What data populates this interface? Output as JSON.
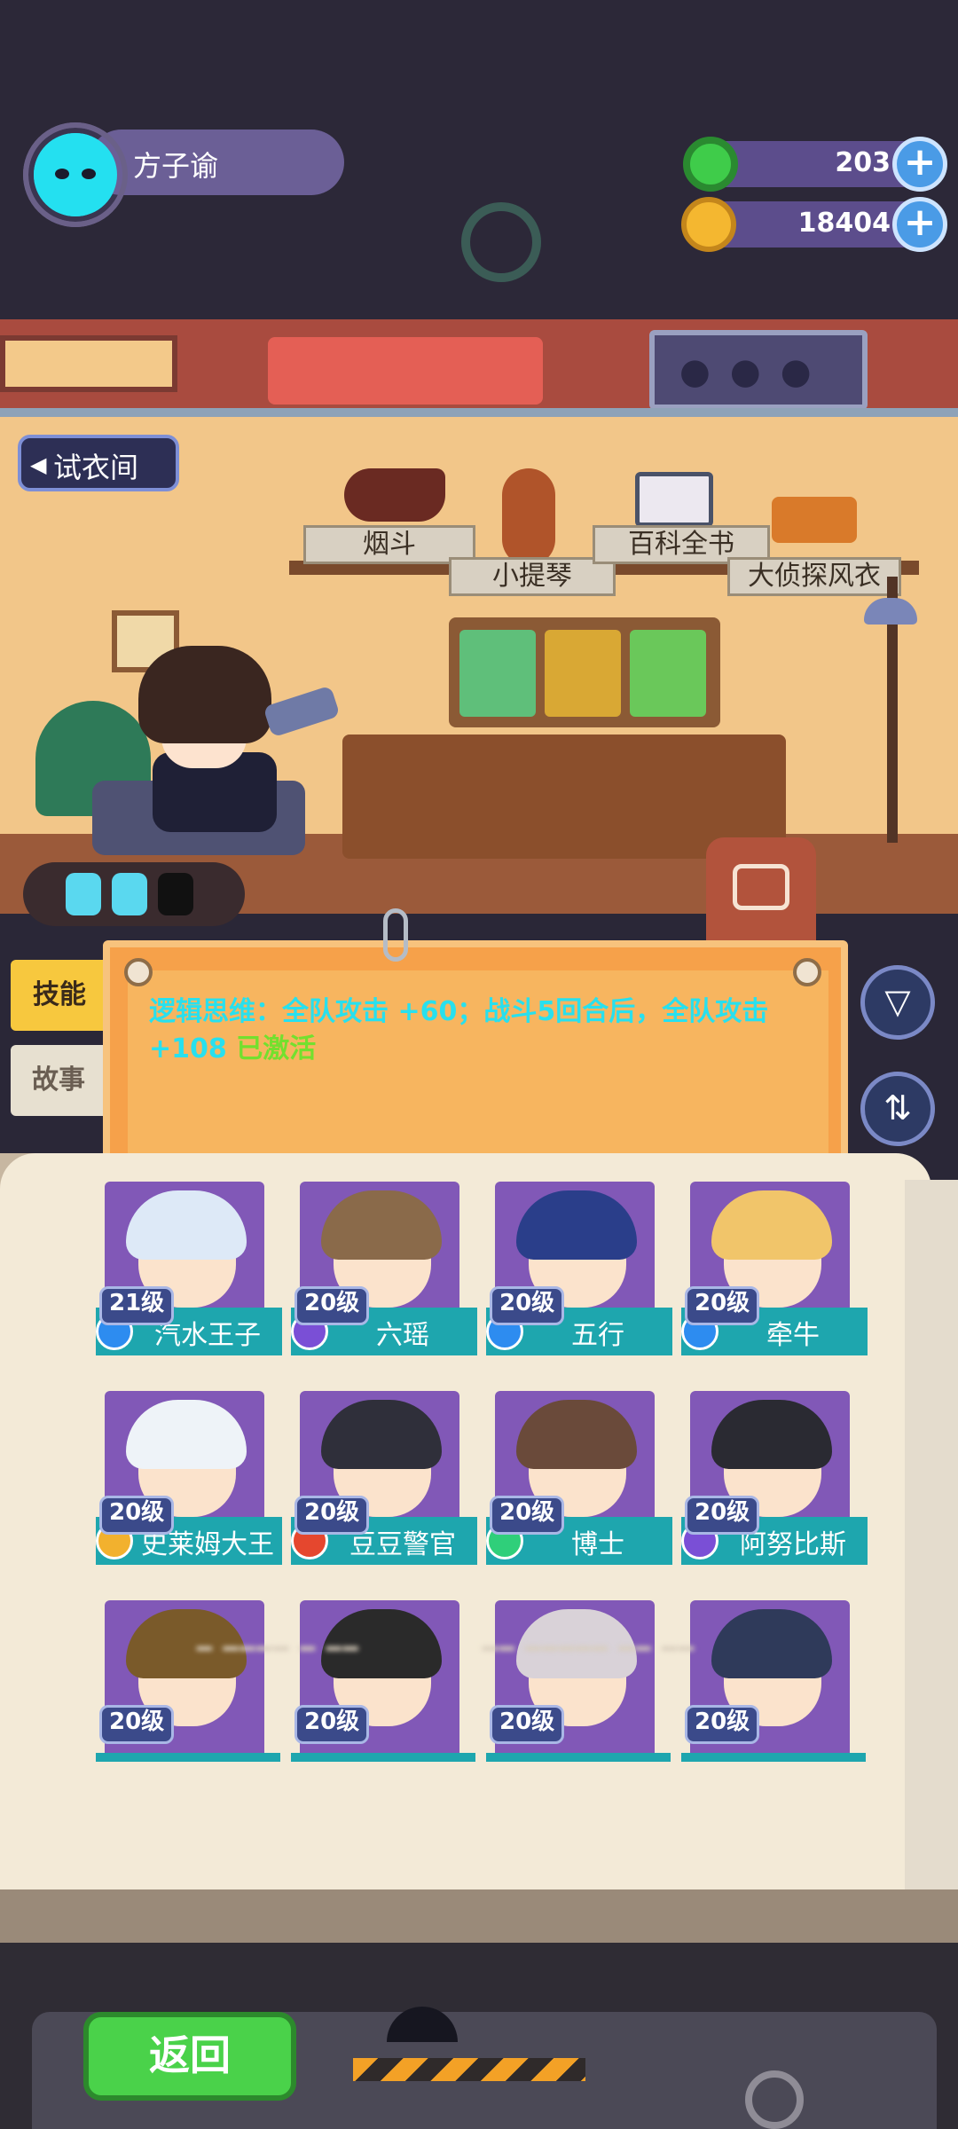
{
  "hud": {
    "player_name": "方子谕",
    "currency_green": {
      "value": "203",
      "icon": "green-donut-icon",
      "color": "#3fcc4a"
    },
    "currency_gold": {
      "value": "18404",
      "icon": "gold-planet-icon",
      "color": "#f4b730"
    },
    "add_icon": "plus-icon"
  },
  "room": {
    "dressing_room_label": "试衣间",
    "shelf_items": [
      {
        "label": "烟斗",
        "icon": "pipe-icon"
      },
      {
        "label": "小提琴",
        "icon": "violin-icon"
      },
      {
        "label": "百科全书",
        "icon": "encyclopedia-icon"
      },
      {
        "label": "大侦探风衣",
        "icon": "coat-icon"
      }
    ]
  },
  "tabs": {
    "skill": "技能",
    "story": "故事"
  },
  "skill": {
    "text": "逻辑思维：全队攻击 +60；战斗5回合后，全队攻击 +108",
    "status": "已激活"
  },
  "side_buttons": {
    "filter_icon": "filter-icon",
    "sort_icon": "sort-icon"
  },
  "characters": [
    {
      "name": "汽水王子",
      "level": "21级",
      "badge_color": "#2d8cf0",
      "hair": "#dde9f7"
    },
    {
      "name": "六瑶",
      "level": "20级",
      "badge_color": "#7a4fd6",
      "hair": "#8a6a4a"
    },
    {
      "name": "五行",
      "level": "20级",
      "badge_color": "#2d8cf0",
      "hair": "#2a3e8a"
    },
    {
      "name": "牵牛",
      "level": "20级",
      "badge_color": "#2d8cf0",
      "hair": "#f1c56a"
    },
    {
      "name": "史莱姆大王",
      "level": "20级",
      "badge_color": "#f2b12e",
      "hair": "#eef3f8"
    },
    {
      "name": "豆豆警官",
      "level": "20级",
      "badge_color": "#e5472e",
      "hair": "#2f2f3a"
    },
    {
      "name": "博士",
      "level": "20级",
      "badge_color": "#2fcf7a",
      "hair": "#6a4a3a"
    },
    {
      "name": "阿努比斯",
      "level": "20级",
      "badge_color": "#7a4fd6",
      "hair": "#2a2a32"
    },
    {
      "name": "",
      "level": "20级",
      "badge_color": "",
      "hair": "#7a5a2a"
    },
    {
      "name": "",
      "level": "20级",
      "badge_color": "",
      "hair": "#2a2a2a"
    },
    {
      "name": "",
      "level": "20级",
      "badge_color": "",
      "hair": "#d9d2d8"
    },
    {
      "name": "",
      "level": "20级",
      "badge_color": "",
      "hair": "#2f3a5a"
    }
  ],
  "bottom": {
    "back_label": "返回"
  }
}
